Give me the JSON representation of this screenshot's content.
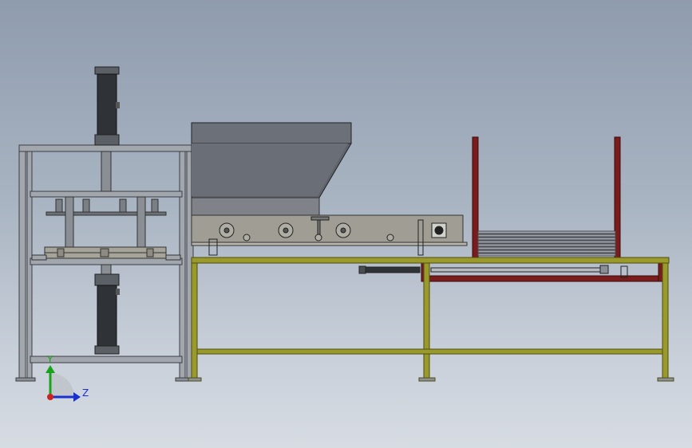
{
  "viewport": {
    "background_top": "#8f9cae",
    "background_bottom": "#d7dce3"
  },
  "colors": {
    "steel_frame": "#a2a6ad",
    "steel_edge": "#3c3f44",
    "yellow_table": "#9a9a2c",
    "red_rack": "#7a1c1c",
    "hopper": "#6c7079",
    "cylinder": "#2f3236"
  },
  "triad": {
    "y_label": "Y",
    "z_label": "Z",
    "y_color": "#1aa31a",
    "z_color": "#1a2fd0",
    "origin_color": "#cc2222"
  }
}
